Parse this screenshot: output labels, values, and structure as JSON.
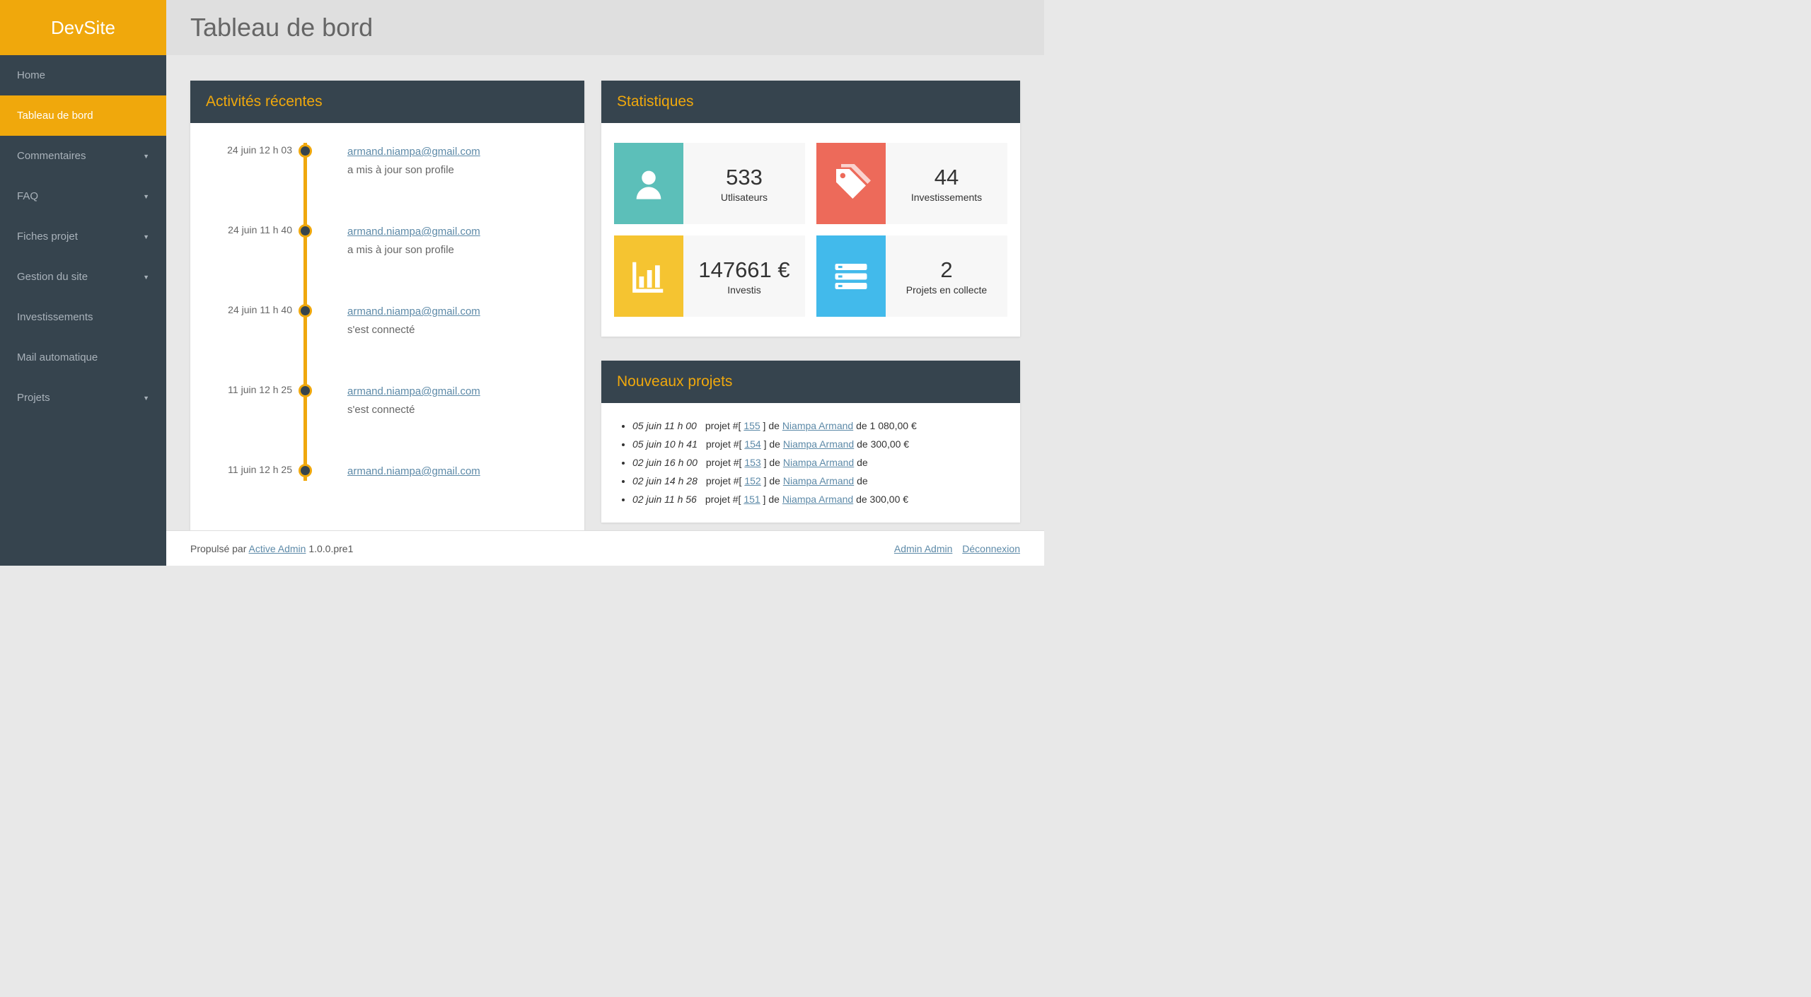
{
  "brand": "DevSite",
  "page_title": "Tableau de bord",
  "nav": [
    {
      "label": "Home",
      "active": false,
      "expandable": false
    },
    {
      "label": "Tableau de bord",
      "active": true,
      "expandable": false
    },
    {
      "label": "Commentaires",
      "active": false,
      "expandable": true
    },
    {
      "label": "FAQ",
      "active": false,
      "expandable": true
    },
    {
      "label": "Fiches projet",
      "active": false,
      "expandable": true
    },
    {
      "label": "Gestion du site",
      "active": false,
      "expandable": true
    },
    {
      "label": "Investissements",
      "active": false,
      "expandable": false
    },
    {
      "label": "Mail automatique",
      "active": false,
      "expandable": false
    },
    {
      "label": "Projets",
      "active": false,
      "expandable": true
    }
  ],
  "panels": {
    "activities_title": "Activités récentes",
    "stats_title": "Statistiques",
    "projects_title": "Nouveaux projets"
  },
  "activities": [
    {
      "date": "24 juin 12 h 03",
      "user": "armand.niampa@gmail.com",
      "action": "a mis à jour son profile"
    },
    {
      "date": "24 juin 11 h 40",
      "user": "armand.niampa@gmail.com",
      "action": "a mis à jour son profile"
    },
    {
      "date": "24 juin 11 h 40",
      "user": "armand.niampa@gmail.com",
      "action": "s'est connecté"
    },
    {
      "date": "11 juin 12 h 25",
      "user": "armand.niampa@gmail.com",
      "action": "s'est connecté"
    },
    {
      "date": "11 juin 12 h 25",
      "user": "armand.niampa@gmail.com",
      "action": ""
    }
  ],
  "stats": [
    {
      "icon": "user",
      "color": "teal",
      "value": "533",
      "label": "Utlisateurs"
    },
    {
      "icon": "tags",
      "color": "coral",
      "value": "44",
      "label": "Investissements"
    },
    {
      "icon": "chart",
      "color": "yellow",
      "value": "147661 €",
      "label": "Investis"
    },
    {
      "icon": "list",
      "color": "blue",
      "value": "2",
      "label": "Projets en collecte"
    }
  ],
  "projects": [
    {
      "date": "05 juin 11 h 00",
      "prefix": "projet #[ ",
      "id": "155",
      "mid": " ] de ",
      "owner": "Niampa Armand",
      "suffix": " de 1 080,00 €"
    },
    {
      "date": "05 juin 10 h 41",
      "prefix": "projet #[ ",
      "id": "154",
      "mid": " ] de ",
      "owner": "Niampa Armand",
      "suffix": " de 300,00 €"
    },
    {
      "date": "02 juin 16 h 00",
      "prefix": "projet #[ ",
      "id": "153",
      "mid": " ] de ",
      "owner": "Niampa Armand",
      "suffix": " de"
    },
    {
      "date": "02 juin 14 h 28",
      "prefix": "projet #[ ",
      "id": "152",
      "mid": " ] de ",
      "owner": "Niampa Armand",
      "suffix": " de"
    },
    {
      "date": "02 juin 11 h 56",
      "prefix": "projet #[ ",
      "id": "151",
      "mid": " ] de ",
      "owner": "Niampa Armand",
      "suffix": " de 300,00 €"
    }
  ],
  "footer": {
    "powered_prefix": "Propulsé par ",
    "powered_link": "Active Admin",
    "version": " 1.0.0.pre1",
    "user": "Admin Admin",
    "logout": "Déconnexion"
  }
}
